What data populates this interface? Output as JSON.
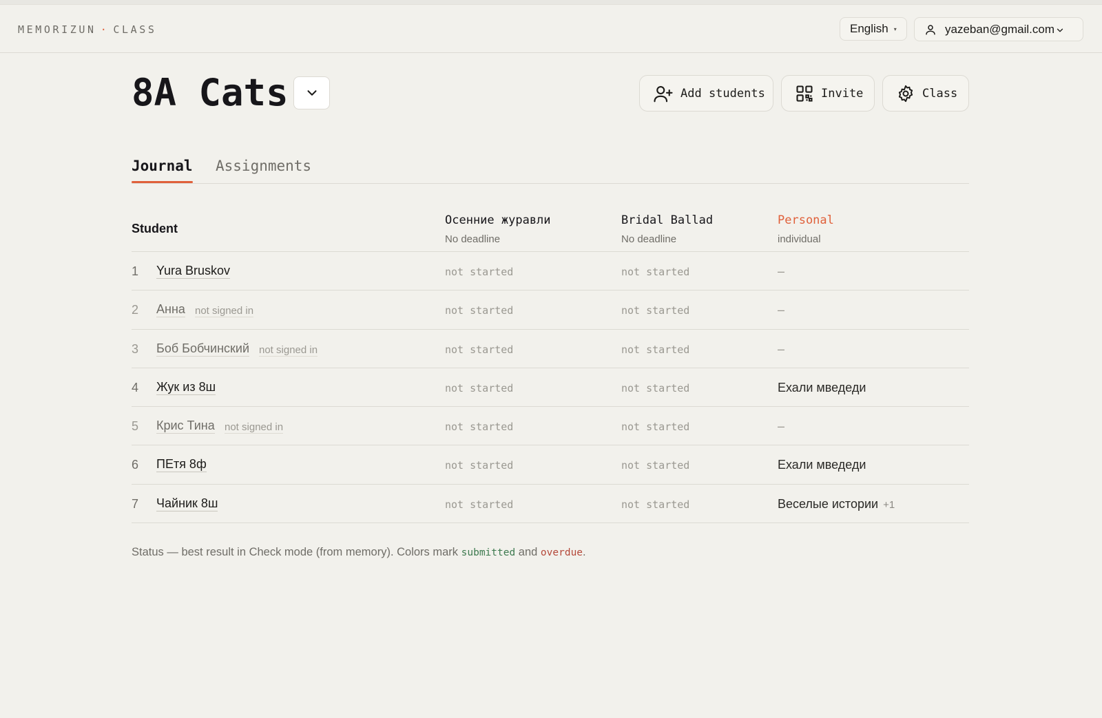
{
  "brand": {
    "name": "MEMORIZUN",
    "separator": "·",
    "section": "CLASS"
  },
  "top_bar": {
    "language": "English",
    "user_email": "yazeban@gmail.com"
  },
  "class_header": {
    "title": "8A Cats",
    "actions": {
      "add_students": "Add students",
      "invite": "Invite",
      "class": "Class"
    }
  },
  "tabs": [
    {
      "label": "Journal",
      "active": true
    },
    {
      "label": "Assignments",
      "active": false
    }
  ],
  "journal": {
    "student_header": "Student",
    "columns": [
      {
        "title": "Осенние журавли",
        "subtitle": "No deadline"
      },
      {
        "title": "Bridal Ballad",
        "subtitle": "No deadline"
      },
      {
        "title": "Personal",
        "subtitle": "individual"
      }
    ],
    "not_signed_label": "not signed in",
    "rows": [
      {
        "num": "1",
        "name": "Yura Bruskov",
        "signed_in": true,
        "a1": "not started",
        "a2": "not started",
        "personal": "–",
        "extra": ""
      },
      {
        "num": "2",
        "name": "Анна",
        "signed_in": false,
        "a1": "not started",
        "a2": "not started",
        "personal": "–",
        "extra": ""
      },
      {
        "num": "3",
        "name": "Боб Бобчинский",
        "signed_in": false,
        "a1": "not started",
        "a2": "not started",
        "personal": "–",
        "extra": ""
      },
      {
        "num": "4",
        "name": "Жук из 8ш",
        "signed_in": true,
        "a1": "not started",
        "a2": "not started",
        "personal": "Ехали мведеди",
        "extra": ""
      },
      {
        "num": "5",
        "name": "Крис Тина",
        "signed_in": false,
        "a1": "not started",
        "a2": "not started",
        "personal": "–",
        "extra": ""
      },
      {
        "num": "6",
        "name": "ПЕтя 8ф",
        "signed_in": true,
        "a1": "not started",
        "a2": "not started",
        "personal": "Ехали мведеди",
        "extra": ""
      },
      {
        "num": "7",
        "name": "Чайник 8ш",
        "signed_in": true,
        "a1": "not started",
        "a2": "not started",
        "personal": "Веселые истории",
        "extra": "+1"
      }
    ]
  },
  "footnote": {
    "text_before": "Status — best result in Check mode (from memory). Colors mark ",
    "submitted": "submitted",
    "and": " and ",
    "overdue": "overdue",
    "end": "."
  },
  "colors": {
    "accent": "#e0603a",
    "background": "#f2f1ec",
    "submitted": "#3d7a4f",
    "overdue": "#b5493a"
  }
}
